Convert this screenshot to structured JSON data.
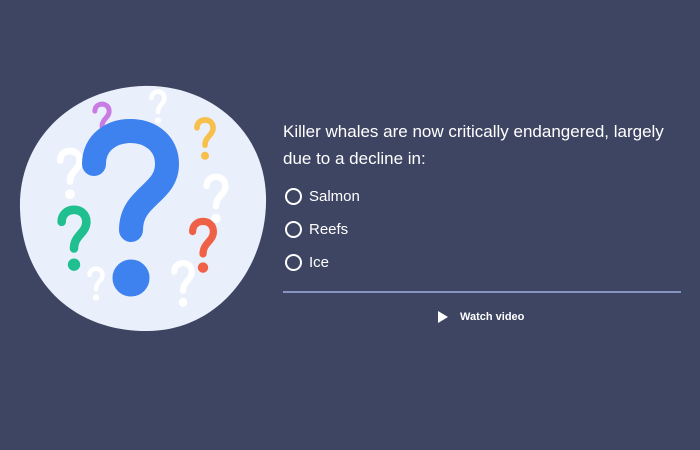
{
  "colors": {
    "background": "#3e4562",
    "divider": "#8794c2",
    "bubble": "#e9effb",
    "big_mark": "#3d82ef",
    "green_mark": "#1fbf8f",
    "red_mark": "#ef6147",
    "yellow_mark": "#f7c04a",
    "purple_mark": "#c77be3",
    "white_mark": "#ffffff"
  },
  "illustration": {
    "icon": "question-marks-bubble-icon"
  },
  "question": {
    "text": "Killer whales are now critically endangered, largely due to a decline in:"
  },
  "options": [
    {
      "label": "Salmon",
      "selected": false
    },
    {
      "label": "Reefs",
      "selected": false
    },
    {
      "label": "Ice",
      "selected": false
    }
  ],
  "watch_video": {
    "label": "Watch video",
    "icon": "play-icon"
  }
}
